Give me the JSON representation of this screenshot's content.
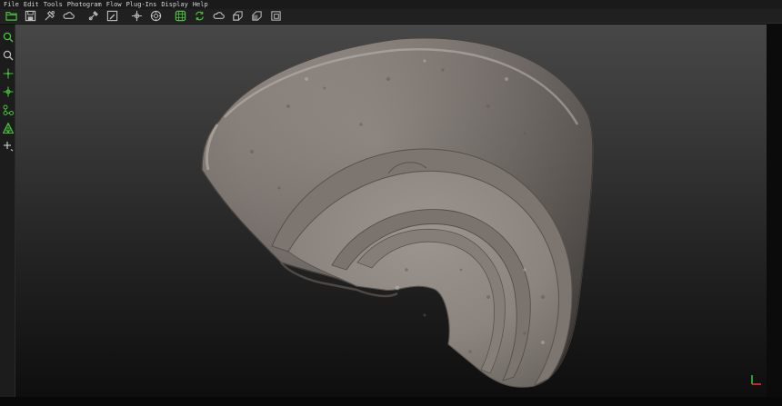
{
  "menu": {
    "items": [
      "File",
      "Edit",
      "Tools",
      "Photogram",
      "Flow",
      "Plug-Ins",
      "Display",
      "Help"
    ]
  },
  "toolbar": {
    "icons": [
      "open-folder-icon",
      "save-icon",
      "tools-icon",
      "cloud-icon",
      "dropper-icon",
      "edit-icon",
      "move-icon",
      "target-icon",
      "grid-icon",
      "sync-icon",
      "cloud-icon",
      "layer-icon",
      "layer-icon",
      "layer-icon"
    ]
  },
  "side_toolbar": {
    "icons": [
      "zoom-icon",
      "zoom-out-icon",
      "pick-point-icon",
      "pick-point-icon",
      "nodes-icon",
      "mesh-icon",
      "add-point-icon"
    ]
  },
  "viewport": {
    "object": "ceramic-fragment",
    "axis_colors": {
      "x": "#ff3030",
      "y": "#30d040"
    }
  },
  "theme": {
    "accent": "#49c23a",
    "icon": "#bdbdbd"
  }
}
